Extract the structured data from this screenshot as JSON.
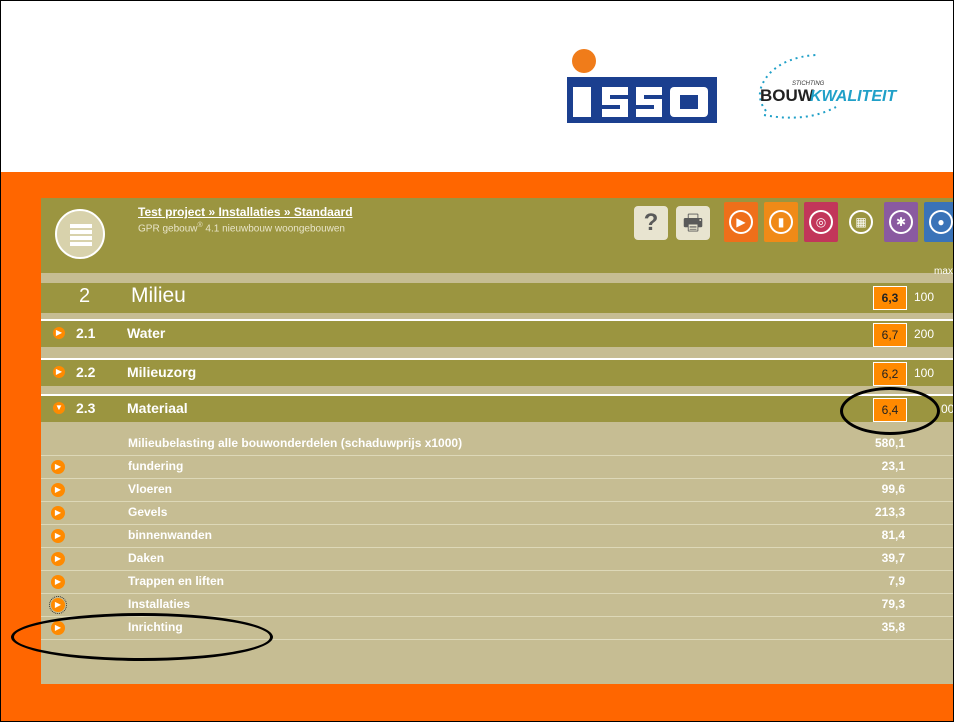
{
  "logos": {
    "isso_text": "isso",
    "bk_stichting": "STICHTING",
    "bk_bouw": "BOUW",
    "bk_kwaliteit": "KWALITEIT"
  },
  "colors": {
    "orange_band": "#ff6600",
    "olive_header": "#9b9540",
    "table_bg": "#c6bd93",
    "score_bg": "#ff8a00",
    "isso_blue": "#1b3f8f",
    "isso_orange": "#f07c1a"
  },
  "header": {
    "breadcrumb": "Test project » Installaties » Standaard",
    "subtitle_prefix": "GPR gebouw",
    "subtitle_suffix": " 4.1 nieuwbouw woongebouwen",
    "reg_mark": "®",
    "help_glyph": "?",
    "print_glyph": "🖶",
    "max_label": "max",
    "toolbar_tabs": [
      {
        "name": "energy-tab",
        "color": "#ef6f1a",
        "glyph": "▶"
      },
      {
        "name": "chart-tab",
        "color": "#f08a17",
        "glyph": "▮"
      },
      {
        "name": "health-tab",
        "color": "#c2365a",
        "glyph": "◎"
      },
      {
        "name": "environment-tab",
        "color": "#9b9540",
        "glyph": "▦"
      },
      {
        "name": "quality-tab",
        "color": "#8a5aa0",
        "glyph": "✱"
      },
      {
        "name": "future-tab",
        "color": "#3a73b8",
        "glyph": "●"
      }
    ]
  },
  "section": {
    "number": "2",
    "title": "Milieu",
    "score": "6,3",
    "max": "100"
  },
  "subsections": [
    {
      "number": "2.1",
      "title": "Water",
      "score": "6,7",
      "max": "200",
      "expanded": false
    },
    {
      "number": "2.2",
      "title": "Milieuzorg",
      "score": "6,2",
      "max": "100",
      "expanded": false
    },
    {
      "number": "2.3",
      "title": "Materiaal",
      "score": "6,4",
      "max": "00",
      "expanded": true
    }
  ],
  "table": {
    "rows": [
      {
        "label": "Milieubelasting alle bouwonderdelen (schaduwprijs x1000)",
        "value": "580,1",
        "bullet": false
      },
      {
        "label": "fundering",
        "value": "23,1",
        "bullet": true
      },
      {
        "label": "Vloeren",
        "value": "99,6",
        "bullet": true
      },
      {
        "label": "Gevels",
        "value": "213,3",
        "bullet": true
      },
      {
        "label": "binnenwanden",
        "value": "81,4",
        "bullet": true
      },
      {
        "label": "Daken",
        "value": "39,7",
        "bullet": true
      },
      {
        "label": "Trappen en liften",
        "value": "7,9",
        "bullet": true
      },
      {
        "label": "Installaties",
        "value": "79,3",
        "bullet": true,
        "selected": true
      },
      {
        "label": "Inrichting",
        "value": "35,8",
        "bullet": true
      }
    ]
  }
}
